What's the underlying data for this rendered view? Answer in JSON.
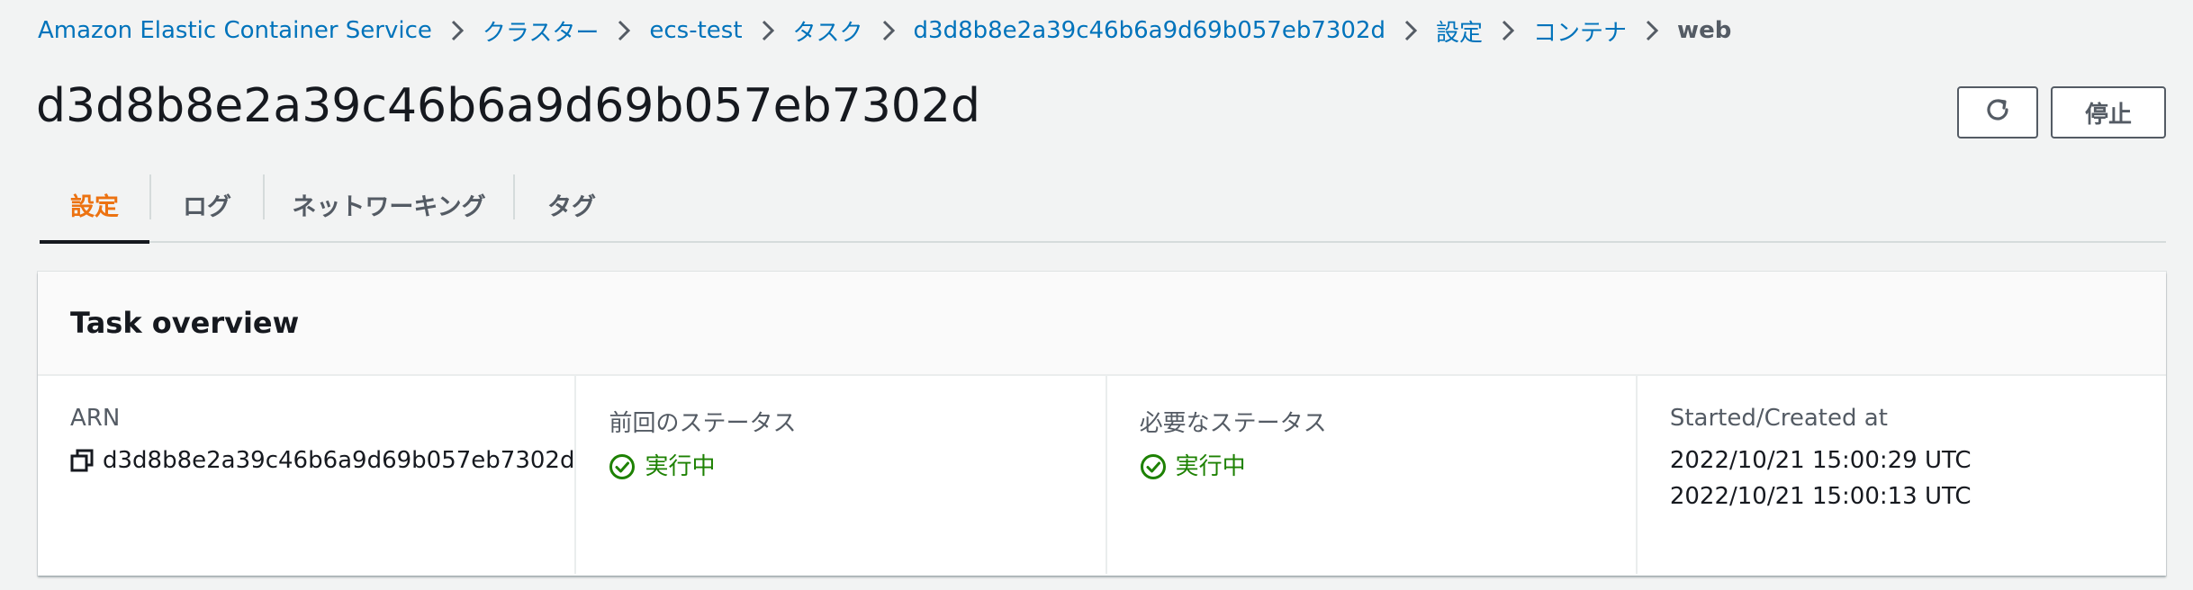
{
  "breadcrumb": {
    "items": [
      {
        "label": "Amazon Elastic Container Service"
      },
      {
        "label": "クラスター"
      },
      {
        "label": "ecs-test"
      },
      {
        "label": "タスク"
      },
      {
        "label": "d3d8b8e2a39c46b6a9d69b057eb7302d"
      },
      {
        "label": "設定"
      },
      {
        "label": "コンテナ"
      },
      {
        "label": "web"
      }
    ]
  },
  "header": {
    "title": "d3d8b8e2a39c46b6a9d69b057eb7302d",
    "refresh_icon": "refresh-icon",
    "stop_label": "停止"
  },
  "tabs": [
    {
      "label": "設定",
      "active": true
    },
    {
      "label": "ログ",
      "active": false
    },
    {
      "label": "ネットワーキング",
      "active": false
    },
    {
      "label": "タグ",
      "active": false
    }
  ],
  "panel": {
    "title": "Task overview",
    "columns": {
      "arn": {
        "label": "ARN",
        "value": "d3d8b8e2a39c46b6a9d69b057eb7302d",
        "icon": "copy-icon"
      },
      "last_status": {
        "label": "前回のステータス",
        "value": "実行中",
        "icon": "status-check-icon"
      },
      "desired_status": {
        "label": "必要なステータス",
        "value": "実行中",
        "icon": "status-check-icon"
      },
      "started": {
        "label": "Started/Created at",
        "values": [
          "2022/10/21 15:00:29 UTC",
          "2022/10/21 15:00:13 UTC"
        ]
      }
    }
  },
  "colors": {
    "link": "#0073bb",
    "active_tab": "#ec7211",
    "success": "#1d8102",
    "background": "#f2f3f3"
  }
}
